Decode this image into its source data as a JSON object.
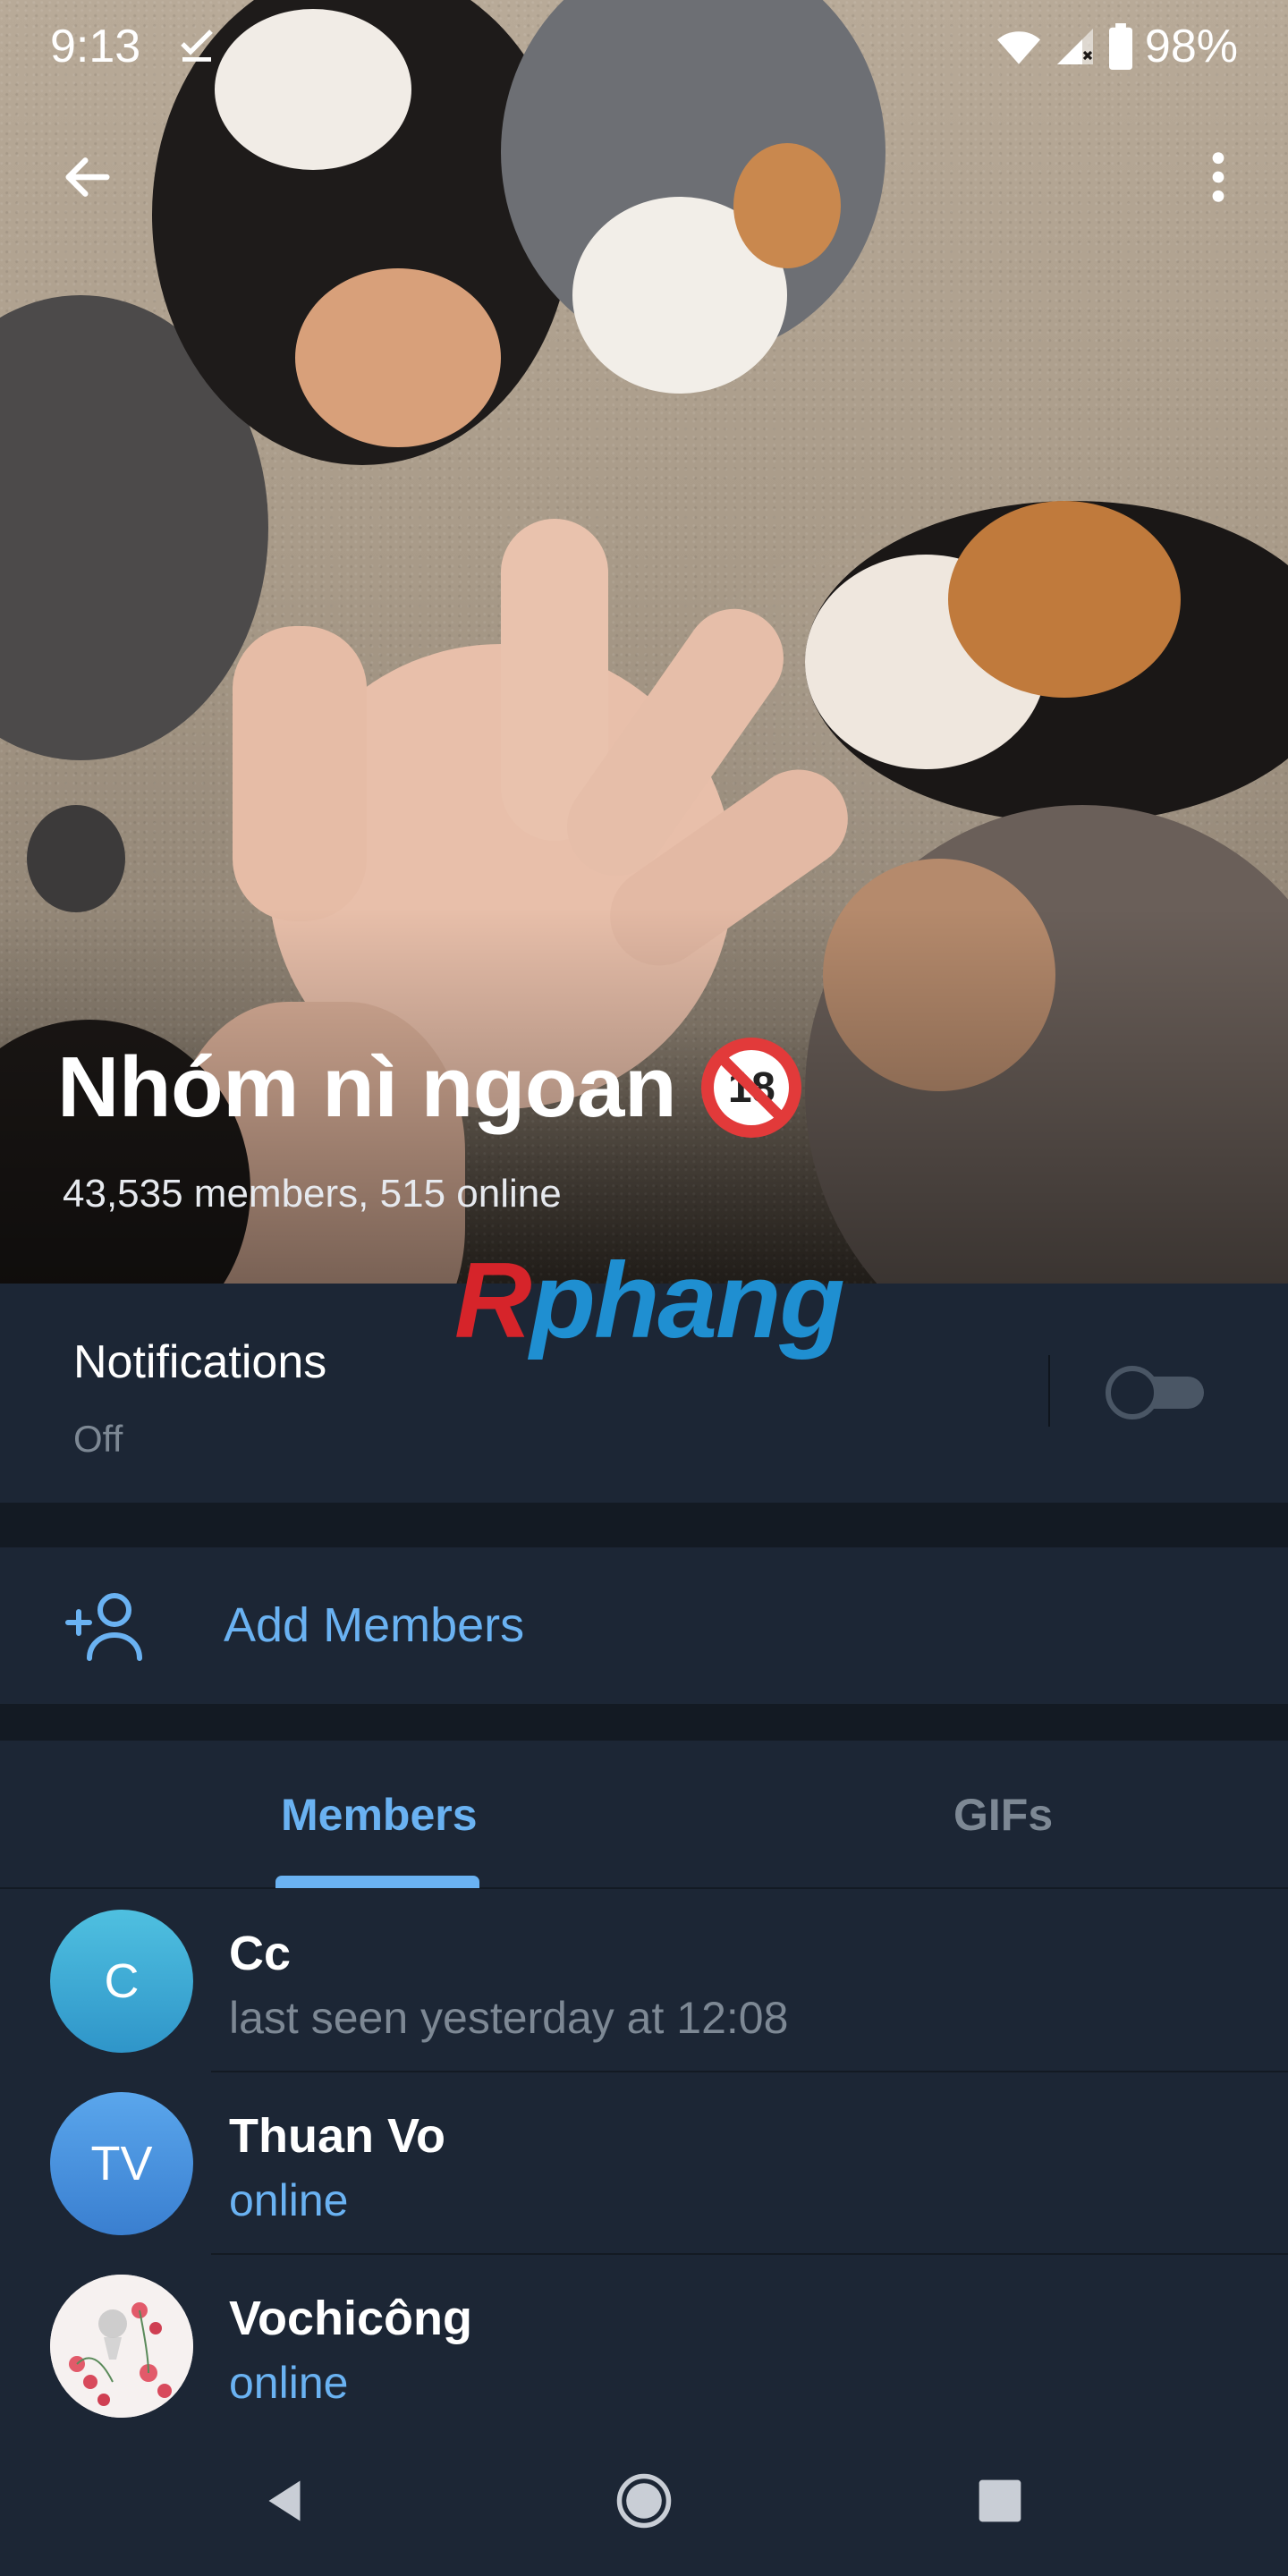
{
  "status_bar": {
    "time": "9:13",
    "battery": "98%",
    "icons": [
      "check-icon",
      "wifi-icon",
      "signal-icon",
      "battery-icon"
    ]
  },
  "header": {
    "group_name": "Nhóm nì ngoan",
    "age_badge": "18",
    "subtitle": "43,535 members, 515 online",
    "watermark_left": "R",
    "watermark_right": "phang"
  },
  "notifications": {
    "label": "Notifications",
    "state": "Off",
    "enabled": false
  },
  "add_members": {
    "label": "Add Members"
  },
  "tabs": [
    {
      "label": "Members",
      "active": true
    },
    {
      "label": "GIFs",
      "active": false
    }
  ],
  "members": [
    {
      "initials": "C",
      "name": "Cc",
      "status": "last seen yesterday at 12:08",
      "online": false,
      "avatar_color": "#3fa7d4"
    },
    {
      "initials": "TV",
      "name": "Thuan Vo",
      "status": "online",
      "online": true,
      "avatar_color": "#4a90d9"
    },
    {
      "initials": "",
      "name": "Vochicông",
      "status": "online",
      "online": true,
      "avatar_color": "#f4eeee"
    }
  ],
  "colors": {
    "accent": "#6ab2f2",
    "background": "#1c2635",
    "divider": "#131a23",
    "muted_text": "#7d8894"
  }
}
